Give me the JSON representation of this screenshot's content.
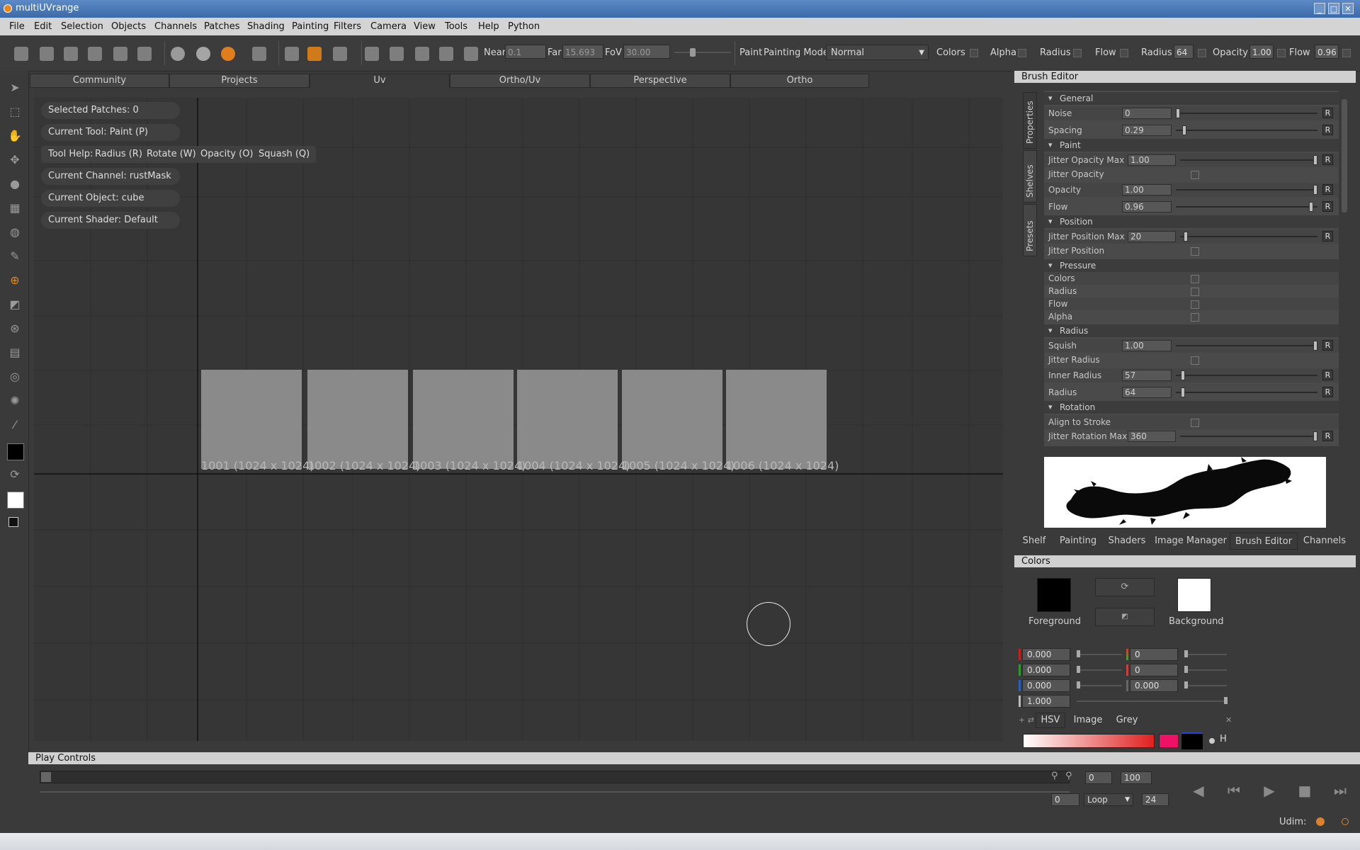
{
  "window": {
    "title": "multiUVrange"
  },
  "menu": [
    "File",
    "Edit",
    "Selection",
    "Objects",
    "Channels",
    "Patches",
    "Shading",
    "Painting",
    "Filters",
    "Camera",
    "View",
    "Tools",
    "Help",
    "Python"
  ],
  "toolbar": {
    "near_label": "Near",
    "near_value": "0.1",
    "far_label": "Far",
    "far_value": "15.693",
    "fov_label": "FoV",
    "fov_value": "30.00",
    "paint_label": "Paint",
    "painting_mode_label": "Painting Mode",
    "painting_mode_value": "Normal",
    "colors_label": "Colors",
    "alpha_label": "Alpha",
    "radius_label": "Radius",
    "flow_label": "Flow",
    "radius2_label": "Radius",
    "radius2_value": "64",
    "opacity_label": "Opacity",
    "opacity_value": "1.00",
    "flow2_label": "Flow",
    "flow2_value": "0.96"
  },
  "view_tabs": [
    "Community",
    "Projects",
    "Uv",
    "Ortho/Uv",
    "Perspective",
    "Ortho"
  ],
  "active_view_tab": "Uv",
  "viewport": {
    "selected_patches": "Selected Patches: 0",
    "current_tool": "Current Tool: Paint (P)",
    "tool_help_label": "Tool Help:",
    "tool_help_items": [
      "Radius (R)",
      "Rotate (W)",
      "Opacity (O)",
      "Squash (Q)"
    ],
    "current_channel": "Current Channel: rustMask",
    "current_object": "Current Object: cube",
    "current_shader": "Current Shader: Default",
    "patches": [
      "1001 (1024 x 1024)",
      "1002 (1024 x 1024)",
      "1003 (1024 x 1024)",
      "1004 (1024 x 1024)",
      "1005 (1024 x 1024)",
      "1006 (1024 x 1024)"
    ]
  },
  "brush_editor": {
    "title": "Brush Editor",
    "side_tabs": [
      "Properties",
      "Shelves",
      "Presets"
    ],
    "sections": {
      "general": "General",
      "paint": "Paint",
      "position": "Position",
      "pressure": "Pressure",
      "radius": "Radius",
      "rotation": "Rotation"
    },
    "rows": {
      "noise": {
        "label": "Noise",
        "value": "0"
      },
      "spacing": {
        "label": "Spacing",
        "value": "0.29"
      },
      "jitter_opacity_max": {
        "label": "Jitter Opacity Max",
        "value": "1.00"
      },
      "jitter_opacity": {
        "label": "Jitter Opacity"
      },
      "opacity": {
        "label": "Opacity",
        "value": "1.00"
      },
      "flow": {
        "label": "Flow",
        "value": "0.96"
      },
      "jitter_position_max": {
        "label": "Jitter Position Max",
        "value": "20"
      },
      "jitter_position": {
        "label": "Jitter Position"
      },
      "p_colors": {
        "label": "Colors"
      },
      "p_radius": {
        "label": "Radius"
      },
      "p_flow": {
        "label": "Flow"
      },
      "p_alpha": {
        "label": "Alpha"
      },
      "squish": {
        "label": "Squish",
        "value": "1.00"
      },
      "jitter_radius": {
        "label": "Jitter Radius"
      },
      "inner_radius": {
        "label": "Inner Radius",
        "value": "57"
      },
      "radius": {
        "label": "Radius",
        "value": "64"
      },
      "align_to_stroke": {
        "label": "Align to Stroke"
      },
      "jitter_rotation_max": {
        "label": "Jitter Rotation Max",
        "value": "360"
      }
    },
    "reset_label": "R"
  },
  "dock_tabs": [
    "Shelf",
    "Painting",
    "Shaders",
    "Image Manager",
    "Brush Editor",
    "Channels"
  ],
  "active_dock_tab": "Brush Editor",
  "colors": {
    "title": "Colors",
    "foreground_label": "Foreground",
    "background_label": "Background",
    "rgb": [
      "0.000",
      "0.000",
      "0.000",
      "1.000"
    ],
    "hsv": [
      "0",
      "0",
      "0.000"
    ],
    "tabs": [
      "HSV",
      "Image",
      "Grey"
    ],
    "hue_label": "H",
    "foreground_color": "#000000",
    "background_color": "#ffffff",
    "accent": "#ee1166"
  },
  "play_controls": {
    "title": "Play Controls",
    "start": "0",
    "end": "100",
    "current": "0",
    "loop": "Loop",
    "fps": "24"
  },
  "status": {
    "udim_label": "Udim:"
  }
}
